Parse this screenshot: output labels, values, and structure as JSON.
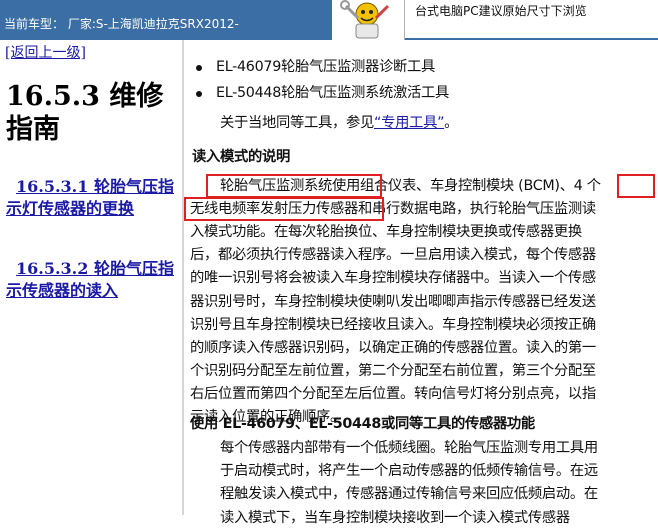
{
  "topbar": {
    "car_label": "当前车型：  厂家:S-上海凯迪拉克SRX2012-",
    "notice": "台式电脑PC建议原始尺寸下浏览"
  },
  "leftnav": {
    "back": "[返回上一级]",
    "title": "16.5.3 维修指南",
    "links": [
      "16.5.3.1 轮胎气压指示灯传感器的更换",
      "16.5.3.2 轮胎气压指示传感器的读入"
    ]
  },
  "main": {
    "bullets": [
      "EL-46079轮胎气压监测器诊断工具",
      "EL-50448轮胎气压监测系统激活工具"
    ],
    "equiv_prefix": "关于当地同等工具，参见",
    "equiv_link": "“专用工具”",
    "equiv_suffix": "。",
    "section1_title": "读入模式的说明",
    "para1_lines": [
      "轮胎气压监测系统使用组合仪表、车身控制模块 (BCM)、4 个",
      "无线电频率发射压力传感器和串行数据电路，执行轮胎气压监测读",
      "入模式功能。在每次轮胎换位、车身控制模块更换或传感器更换",
      "后，都必须执行传感器读入程序。一旦启用读入模式，每个传感器",
      "的唯一识别号将会被读入车身控制模块存储器中。当读入一个传感",
      "器识别号时，车身控制模块使喇叭发出唧唧声指示传感器已经发送",
      "识别号且车身控制模块已经接收且读入。车身控制模块必须按正确",
      "的顺序读入传感器识别码，以确定正确的传感器位置。读入的第一",
      "个识别码分配至左前位置，第二个分配至右前位置，第三个分配至",
      "右后位置而第四个分配至左后位置。转向信号灯将分别点亮，以指",
      "示读入位置的正确顺序。"
    ],
    "section2_title": "使用 EL-46079、EL-50448或同等工具的传感器功能",
    "para2_lines": [
      "每个传感器内部带有一个低频线圈。轮胎气压监测专用工具用",
      "于启动模式时，将产生一个启动传感器的低频传输信号。在远",
      "程触发读入模式中，传感器通过传输信号来回应低频启动。在",
      "读入模式下，当车身控制模块接收到一个读入模式传感器"
    ]
  }
}
